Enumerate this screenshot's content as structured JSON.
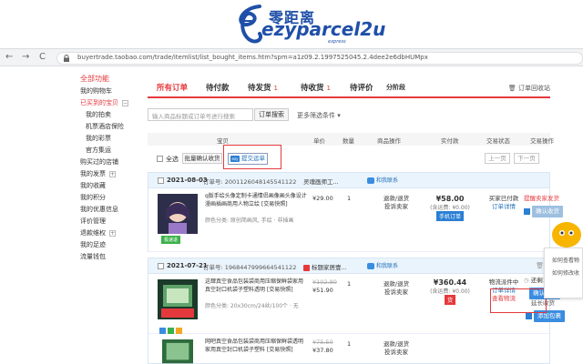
{
  "banner": {
    "logo_cn": "零距离",
    "logo_en": "ezyparcel2u",
    "logo_sub": "express"
  },
  "browser": {
    "back": "←",
    "forward": "→",
    "reload": "C",
    "url": "buyertrade.taobao.com/trade/itemlist/list_bought_items.htm?spm=a1z09.2.1997525045.2.4dee2e6dbHUMpx"
  },
  "sidebar": {
    "items": [
      {
        "label": "全部功能",
        "kind": "head"
      },
      {
        "label": "我的购物车",
        "kind": "item"
      },
      {
        "label": "已买到的宝贝",
        "kind": "sel",
        "toggle": "−"
      },
      {
        "label": "我的拍卖",
        "kind": "sub"
      },
      {
        "label": "机票酒店保险",
        "kind": "sub"
      },
      {
        "label": "我的彩票",
        "kind": "sub"
      },
      {
        "label": "官方集运",
        "kind": "sub"
      },
      {
        "label": "购买过的店铺",
        "kind": "item"
      },
      {
        "label": "我的发票",
        "kind": "item",
        "toggle": "+"
      },
      {
        "label": "我的收藏",
        "kind": "item"
      },
      {
        "label": "我的积分",
        "kind": "item"
      },
      {
        "label": "我的优惠信息",
        "kind": "item"
      },
      {
        "label": "评价管理",
        "kind": "item"
      },
      {
        "label": "退款维权",
        "kind": "item",
        "toggle": "+"
      },
      {
        "label": "我的足迹",
        "kind": "item"
      },
      {
        "label": "流量钱包",
        "kind": "item"
      }
    ]
  },
  "tabs": [
    {
      "label": "所有订单",
      "count": ""
    },
    {
      "label": "待付款",
      "count": ""
    },
    {
      "label": "待发货",
      "count": "1"
    },
    {
      "label": "待收货",
      "count": "1"
    },
    {
      "label": "待评价",
      "count": ""
    },
    {
      "label": "分阶段",
      "count": ""
    }
  ],
  "recycle_label": "订单回收站",
  "search": {
    "placeholder": "输入商品标题或订单号进行搜索",
    "button": "订单搜索",
    "more": "更多筛选条件 ▾"
  },
  "table_header": [
    "宝贝",
    "单价",
    "数量",
    "商品操作",
    "实付款",
    "交易状态",
    "交易操作"
  ],
  "batch": {
    "select_all": "全选",
    "confirm": "批量确认收货",
    "ezy_submit": "提交运单",
    "prev": "上一页",
    "next": "下一页"
  },
  "orders": [
    {
      "date": "2021-08-03",
      "order_no": "订单号: 2001126048145541122",
      "shop": "灵魂画师工...",
      "contact": "和我联系",
      "product": {
        "name": "q版手绘头像定制卡通情侣画像画头像设计漫画插画商用人物立绘 [交易快照]",
        "attrs": "颜色分类: 原创简画风, 手绘 · 非插画",
        "price": "¥29.00",
        "qty": "1",
        "ops": [
          "退款/退货",
          "投诉卖家"
        ],
        "total": "¥58.00",
        "total_note": "(含运费: ¥0.00)",
        "pay_tag": "手机订单",
        "status": [
          "买家已付款",
          "订单详情"
        ],
        "actions": [
          "提醒卖家发货",
          "确认收货"
        ],
        "badge": "极速退"
      }
    },
    {
      "date": "2021-07-21",
      "order_no": "订单号: 1968447999664541122",
      "shop": "标题家居壹...",
      "contact": "和我联系",
      "product": {
        "name": "这肆真空食品包装袋商用压缩保鲜袋家用真空封口机袋子塑料透明 [交易快照]",
        "attrs": "颜色分类: 20x30cm/24丝/100个 · 无",
        "price_old": "¥102.80",
        "price": "¥51.90",
        "qty": "1",
        "ops": [
          "退款/退货",
          "投诉卖家"
        ],
        "total": "¥360.44",
        "total_note": "(含运费: ¥0.00)",
        "pay_tag": "货",
        "status": [
          "物流派件中",
          "订单详情",
          "查看物流"
        ],
        "actions": [
          "还剩1天17时",
          "确认收货",
          "延长收货",
          "添加包裹"
        ]
      }
    },
    {
      "product": {
        "name": "网吧真空食品包装袋商用压缩保鲜袋透明家用真空封口机袋子塑料 [交易快照]",
        "price_old": "¥75.50",
        "price": "¥37.80",
        "qty": "1",
        "ops": [
          "退款/退货",
          "投诉卖家"
        ]
      }
    }
  ],
  "float_widget": {
    "lines": [
      "如何查看物",
      "如何修改收"
    ]
  }
}
